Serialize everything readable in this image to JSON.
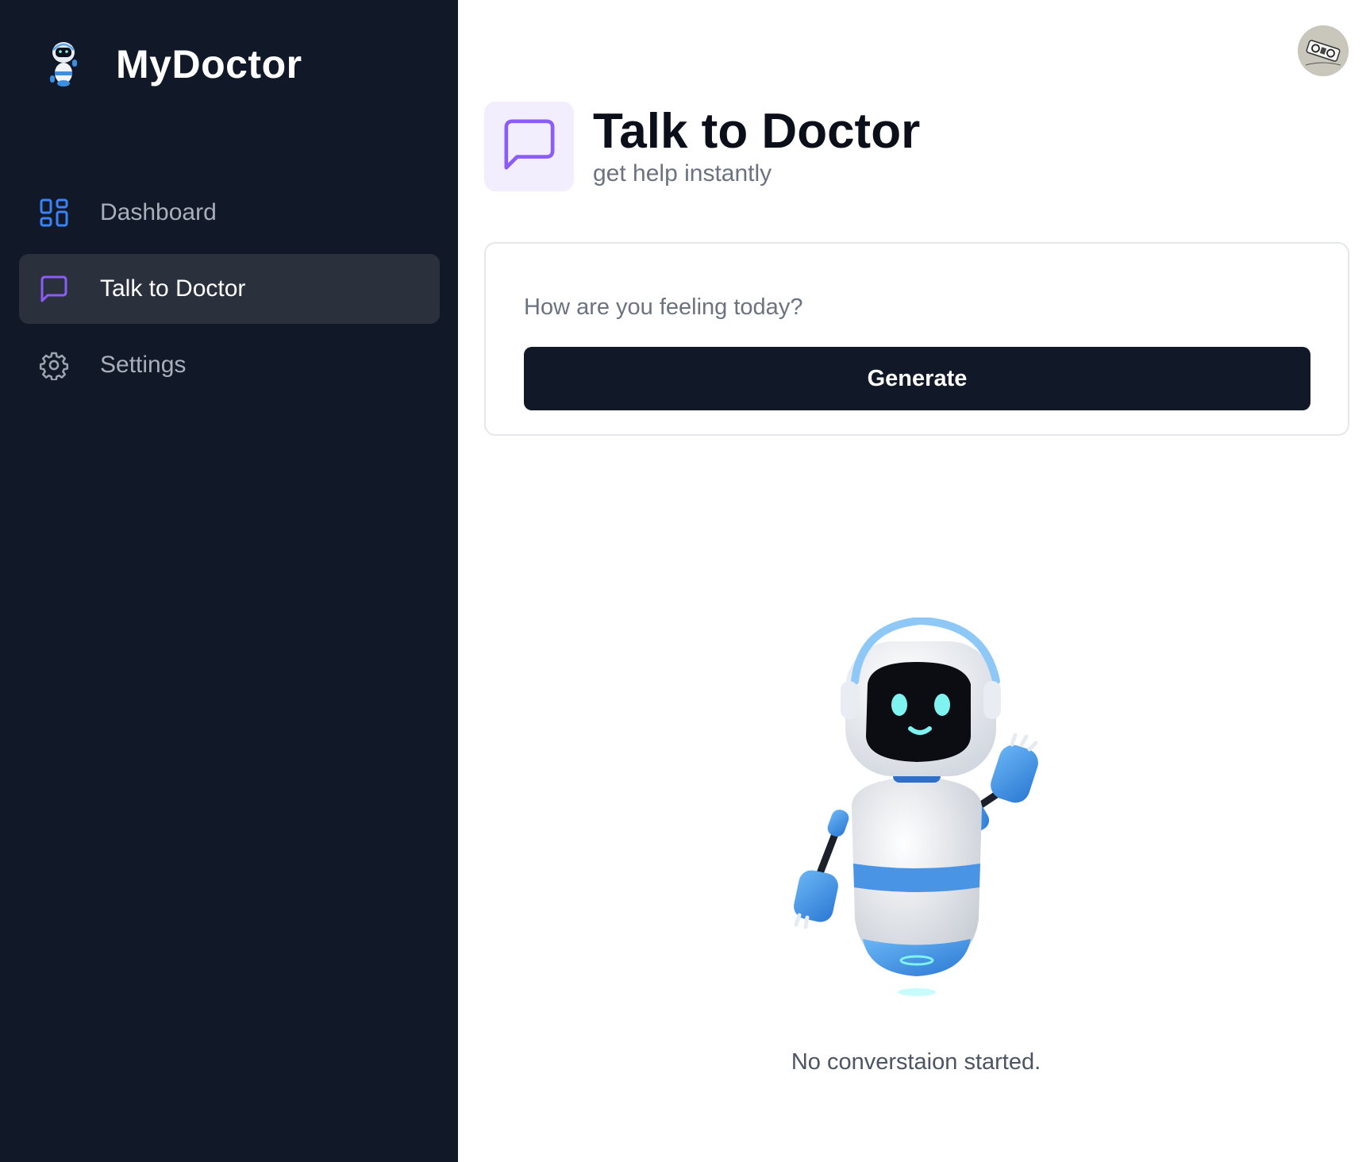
{
  "brand": {
    "name": "MyDoctor",
    "logo_icon": "robot-logo-icon"
  },
  "sidebar": {
    "items": [
      {
        "label": "Dashboard",
        "icon": "dashboard-grid-icon",
        "active": false,
        "icon_color": "#3b82f6"
      },
      {
        "label": "Talk to Doctor",
        "icon": "chat-bubble-icon",
        "active": true,
        "icon_color": "#8b5cf6"
      },
      {
        "label": "Settings",
        "icon": "gear-icon",
        "active": false,
        "icon_color": "#9ca3af"
      }
    ]
  },
  "header": {
    "title": "Talk to Doctor",
    "subtitle": "get help instantly",
    "icon": "chat-bubble-icon",
    "icon_color": "#8b5cf6"
  },
  "form": {
    "placeholder": "How are you feeling today?",
    "value": "",
    "button_label": "Generate"
  },
  "conversation": {
    "empty_message": "No converstaion started.",
    "illustration": "waving-robot-illustration"
  },
  "user": {
    "avatar": "user-avatar"
  },
  "colors": {
    "sidebar_bg": "#111827",
    "active_item_bg": "#2a303c",
    "accent": "#8b5cf6",
    "button_bg": "#111827"
  }
}
